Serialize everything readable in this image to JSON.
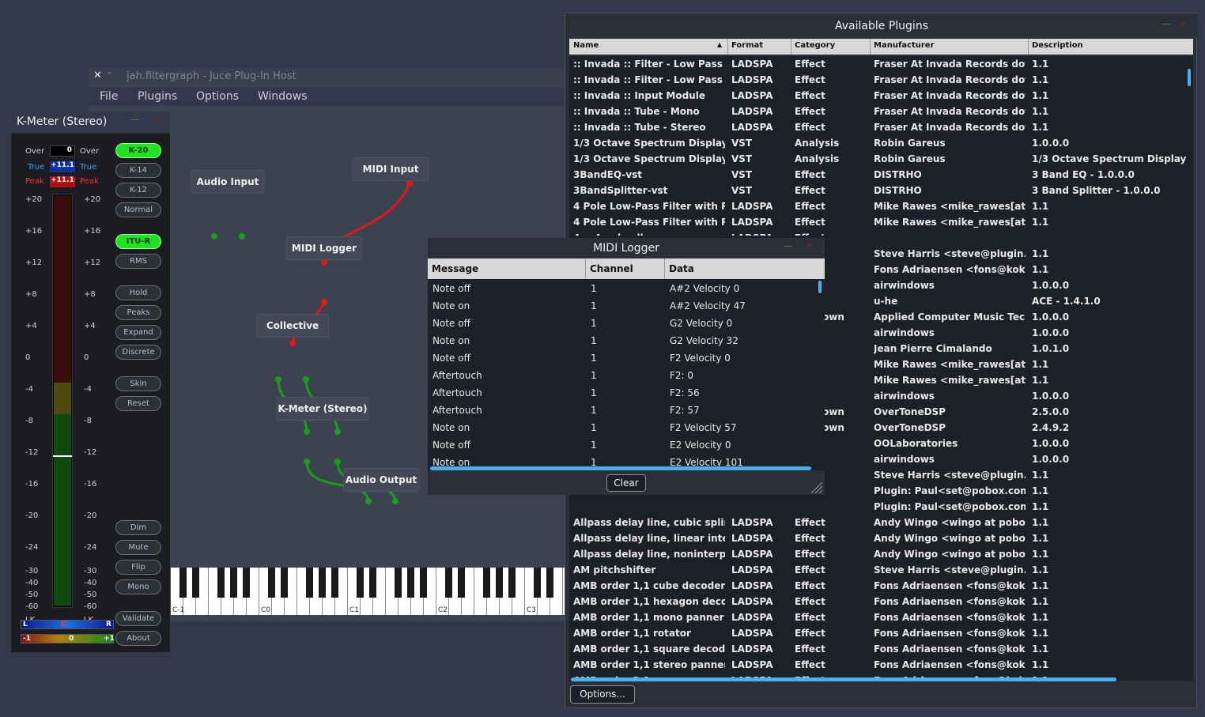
{
  "host": {
    "title": "jah.filtergraph - Juce Plug-In Host",
    "close_glyph": "✕",
    "pin_glyph": "⌃",
    "menu": [
      "File",
      "Plugins",
      "Options",
      "Windows"
    ]
  },
  "graph": {
    "nodes": {
      "audio_input": "Audio Input",
      "midi_input": "MIDI Input",
      "midi_logger": "MIDI Logger",
      "collective": "Collective",
      "kmeter": "K-Meter (Stereo)",
      "audio_output": "Audio Output"
    }
  },
  "keyboard": {
    "labels": [
      "C-1",
      "C0",
      "C1",
      "C2",
      "C3"
    ]
  },
  "kmeter": {
    "title": "K-Meter (Stereo)",
    "over_label": "Over",
    "true_label": "True",
    "peak_label": "Peak",
    "over_value": "0",
    "true_value": "+11.1",
    "peak_value": "+11.1",
    "scale": [
      "+20",
      "+16",
      "+12",
      "+8",
      "+4",
      "0",
      "-4",
      "-8",
      "-12",
      "-16",
      "-20",
      "-24",
      "-30",
      "-40",
      "-50",
      "-60",
      "LK"
    ],
    "buttons": [
      "K-20",
      "K-14",
      "K-12",
      "Normal",
      "ITU-R",
      "RMS",
      "Hold",
      "Peaks",
      "Expand",
      "Discrete",
      "Skin",
      "Reset",
      "Dim",
      "Mute",
      "Flip",
      "Mono",
      "Validate",
      "About"
    ],
    "active": [
      "K-20",
      "ITU-R"
    ],
    "balance": {
      "left": "L",
      "center": "C",
      "right": "R"
    },
    "correlation": {
      "left": "-1",
      "center": "0",
      "right": "+1"
    },
    "accent": "#22e022"
  },
  "plugins": {
    "title": "Available Plugins",
    "columns": [
      "Name",
      "Format",
      "Category",
      "Manufacturer",
      "Description"
    ],
    "sort_glyph": "▲",
    "rows_top": [
      [
        ":: Invada :: Filter - Low Pass M...",
        "LADSPA",
        "Effect",
        "Fraser At Invada Records dot ...",
        "1.1"
      ],
      [
        ":: Invada :: Filter - Low Pass St...",
        "LADSPA",
        "Effect",
        "Fraser At Invada Records dot ...",
        "1.1"
      ],
      [
        ":: Invada :: Input Module",
        "LADSPA",
        "Effect",
        "Fraser At Invada Records dot ...",
        "1.1"
      ],
      [
        ":: Invada :: Tube - Mono",
        "LADSPA",
        "Effect",
        "Fraser At Invada Records dot ...",
        "1.1"
      ],
      [
        ":: Invada :: Tube - Stereo",
        "LADSPA",
        "Effect",
        "Fraser At Invada Records dot ...",
        "1.1"
      ],
      [
        "1/3 Octave Spectrum Display ...",
        "VST",
        "Analysis",
        "Robin Gareus",
        "1.0.0.0"
      ],
      [
        "1/3 Octave Spectrum Display ...",
        "VST",
        "Analysis",
        "Robin Gareus",
        "1/3 Octave Spectrum Display :"
      ],
      [
        "3BandEQ-vst",
        "VST",
        "Effect",
        "DISTRHO",
        "3 Band EQ - 1.0.0.0"
      ],
      [
        "3BandSplitter-vst",
        "VST",
        "Effect",
        "DISTRHO",
        "3 Band Splitter - 1.0.0.0"
      ],
      [
        "4 Pole Low-Pass Filter with Re...",
        "LADSPA",
        "Effect",
        "Mike Rawes <mike_rawes[at]...",
        "1.1"
      ],
      [
        "4 Pole Low-Pass Filter with Re...",
        "LADSPA",
        "Effect",
        "Mike Rawes <mike_rawes[at]...",
        "1.1"
      ]
    ],
    "rows_right": [
      [
        "",
        "Steve Harris <steve@plugin.or...",
        "1.1"
      ],
      [
        "",
        "Fons Adriaensen <fons@kokki...",
        "1.1"
      ],
      [
        "",
        "airwindows",
        "1.0.0.0"
      ],
      [
        "",
        "u-he",
        "ACE - 1.4.1.0"
      ],
      [
        "own",
        "Applied Computer Music Techn...",
        "1.0.0.0"
      ],
      [
        "",
        "airwindows",
        "1.0.0.0"
      ],
      [
        "",
        "Jean Pierre Cimalando",
        "1.0.1.0"
      ],
      [
        "",
        "Mike Rawes <mike_rawes[at]...",
        "1.1"
      ],
      [
        "",
        "Mike Rawes <mike_rawes[at]...",
        "1.1"
      ],
      [
        "",
        "airwindows",
        "1.0.0.0"
      ],
      [
        "own",
        "OverToneDSP",
        "2.5.0.0"
      ],
      [
        "own",
        "OverToneDSP",
        "2.4.9.2"
      ],
      [
        "",
        "OOLaboratories",
        "1.0.0.0"
      ],
      [
        "",
        "airwindows",
        "1.0.0.0"
      ],
      [
        "",
        "Steve Harris <steve@plugin.or...",
        "1.1"
      ],
      [
        "",
        "Plugin: Paul<set@pobox.com>...",
        "1.1"
      ],
      [
        "",
        "Plugin: Paul<set@pobox.com>...",
        "1.1"
      ]
    ],
    "rows_bottom": [
      [
        "Allpass delay line, cubic spline ...",
        "LADSPA",
        "Effect",
        "Andy Wingo <wingo at pobox ...",
        "1.1"
      ],
      [
        "Allpass delay line, linear interp...",
        "LADSPA",
        "Effect",
        "Andy Wingo <wingo at pobox ...",
        "1.1"
      ],
      [
        "Allpass delay line, noninterpol...",
        "LADSPA",
        "Effect",
        "Andy Wingo <wingo at pobox ...",
        "1.1"
      ],
      [
        "AM pitchshifter",
        "LADSPA",
        "Effect",
        "Steve Harris <steve@plugin.or...",
        "1.1"
      ],
      [
        "AMB order 1,1 cube decoder",
        "LADSPA",
        "Effect",
        "Fons Adriaensen <fons@kokki...",
        "1.1"
      ],
      [
        "AMB order 1,1 hexagon decoder",
        "LADSPA",
        "Effect",
        "Fons Adriaensen <fons@kokki...",
        "1.1"
      ],
      [
        "AMB order 1,1 mono panner",
        "LADSPA",
        "Effect",
        "Fons Adriaensen <fons@kokki...",
        "1.1"
      ],
      [
        "AMB order 1,1 rotator",
        "LADSPA",
        "Effect",
        "Fons Adriaensen <fons@kokki...",
        "1.1"
      ],
      [
        "AMB order 1,1 square decoder",
        "LADSPA",
        "Effect",
        "Fons Adriaensen <fons@kokki...",
        "1.1"
      ],
      [
        "AMB order 1,1 stereo panner",
        "LADSPA",
        "Effect",
        "Fons Adriaensen <fons@kokki...",
        "1.1"
      ],
      [
        "AMB order 2,1 panner",
        "LADSPA",
        "Effect",
        "Fons Adriaensen <fons@kokki...",
        "1.1"
      ]
    ],
    "partial_row": [
      "4 -- 4 pole allpass",
      "LADSPA",
      "Effect"
    ],
    "options_button": "Options..."
  },
  "midi_logger": {
    "title": "MIDI Logger",
    "columns": [
      "Message",
      "Channel",
      "Data"
    ],
    "rows": [
      [
        "Note off",
        "1",
        "A#2 Velocity 0"
      ],
      [
        "Note on",
        "1",
        "A#2 Velocity 47"
      ],
      [
        "Note off",
        "1",
        "G2 Velocity 0"
      ],
      [
        "Note on",
        "1",
        "G2 Velocity 32"
      ],
      [
        "Note off",
        "1",
        "F2 Velocity 0"
      ],
      [
        "Aftertouch",
        "1",
        "F2: 0"
      ],
      [
        "Aftertouch",
        "1",
        "F2: 56"
      ],
      [
        "Aftertouch",
        "1",
        "F2: 57"
      ],
      [
        "Note on",
        "1",
        "F2 Velocity 57"
      ],
      [
        "Note off",
        "1",
        "E2 Velocity 0"
      ],
      [
        "Note on",
        "1",
        "E2 Velocity 101"
      ]
    ],
    "clear_button": "Clear"
  },
  "colors": {
    "scroll_accent": "#4ab0e8",
    "midi_wire": "#e01818",
    "audio_wire": "#1a9e1a"
  }
}
